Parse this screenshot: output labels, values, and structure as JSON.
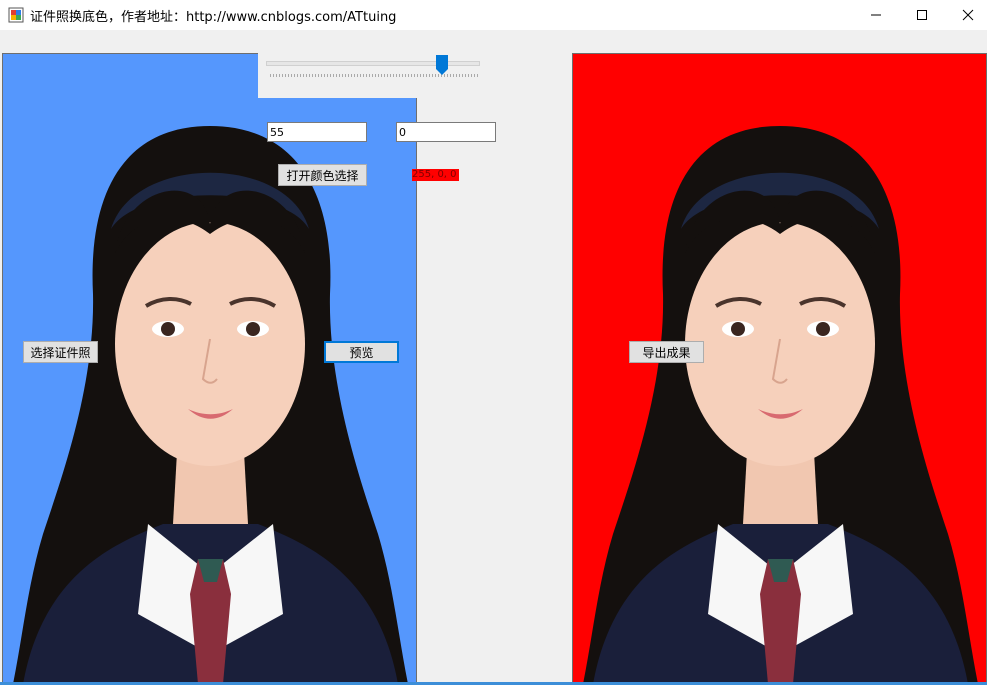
{
  "window": {
    "title": "证件照换底色，作者地址：http://www.cnblogs.com/ATtuing",
    "controls": {
      "minimize": "minimize-icon",
      "maximize": "maximize-icon",
      "close": "close-icon"
    }
  },
  "trackbar": {
    "value_fraction": 0.83
  },
  "inputs": {
    "threshold_value": "55",
    "second_value": "0"
  },
  "buttons": {
    "open_color_picker": "打开颜色选择",
    "select_photo": "选择证件照",
    "preview": "预览",
    "export_result": "导出成果"
  },
  "color_label": {
    "text": "255, 0, 0",
    "color": "#ff0000"
  },
  "images": {
    "source_background_color": "#5597fd",
    "result_background_color": "#ff0000"
  },
  "colors": {
    "accent": "#0078d7"
  }
}
